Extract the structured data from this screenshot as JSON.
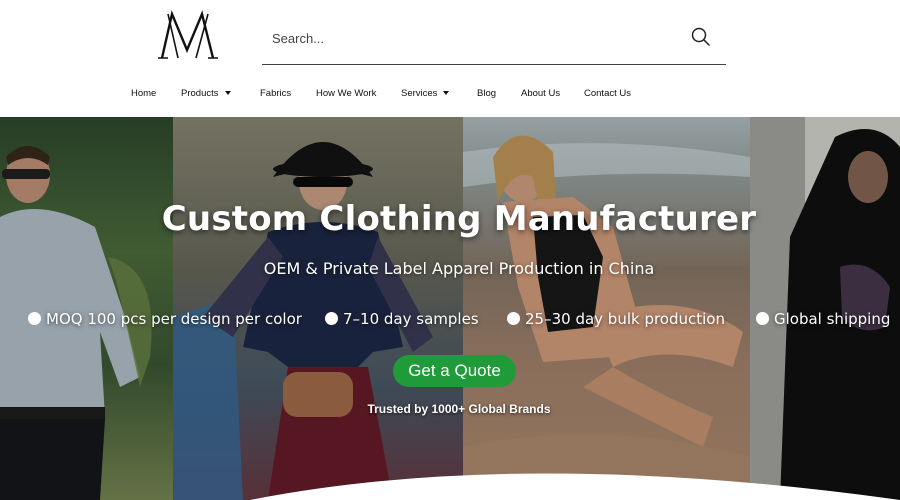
{
  "header": {
    "logo_text": "MM",
    "search": {
      "placeholder": "Search..."
    }
  },
  "nav": {
    "items": [
      {
        "label": "Home",
        "dropdown": false
      },
      {
        "label": "Products",
        "dropdown": true
      },
      {
        "label": "Fabrics",
        "dropdown": false
      },
      {
        "label": "How We Work",
        "dropdown": false
      },
      {
        "label": "Services",
        "dropdown": true
      },
      {
        "label": "Blog",
        "dropdown": false
      },
      {
        "label": "About Us",
        "dropdown": false
      },
      {
        "label": "Contact Us",
        "dropdown": false
      }
    ]
  },
  "hero": {
    "title": "Custom Clothing Manufacturer",
    "subtitle": "OEM & Private Label Apparel Production in China",
    "bullets": [
      "MOQ 100 pcs per design per color",
      "7–10 day samples",
      "25–30 day bulk production",
      "Global shipping"
    ],
    "cta_label": "Get a Quote",
    "trusted_text": "Trusted by 1000+ Global Brands"
  },
  "colors": {
    "cta_green": "#1f9b3a",
    "text_dark": "#111111",
    "hero_text": "#ffffff"
  },
  "icons": [
    "logo-mark",
    "search-icon",
    "chevron-down-icon",
    "bullet-dot-icon"
  ]
}
